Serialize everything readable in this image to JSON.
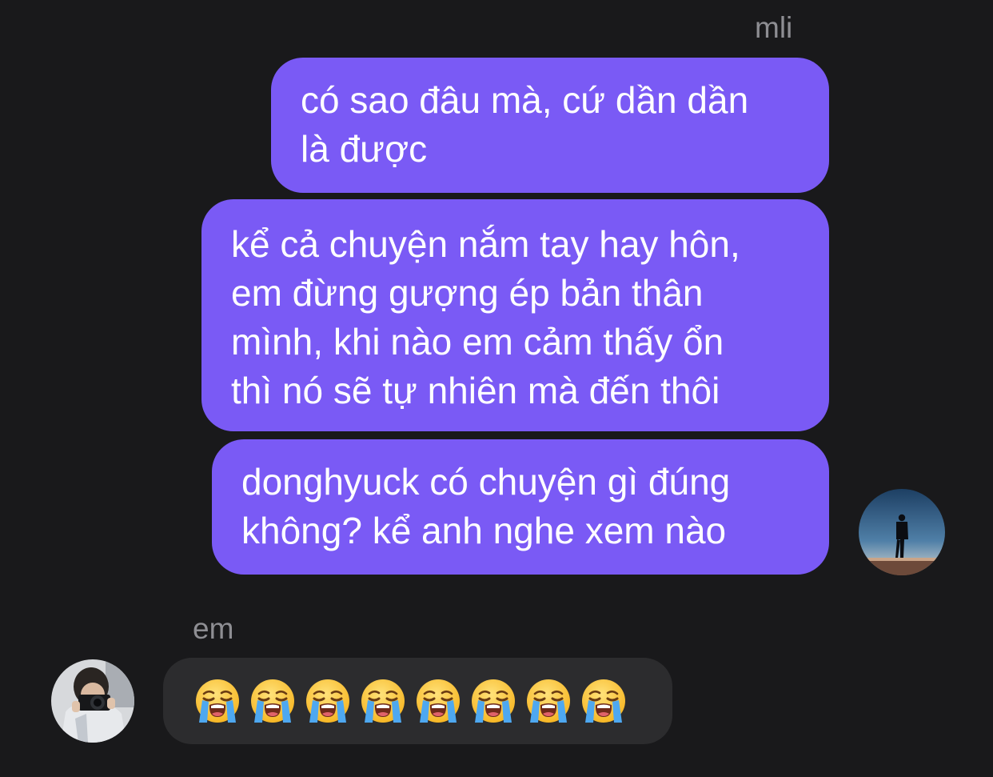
{
  "outgoing": {
    "sender_name": "mli",
    "messages": [
      {
        "lines": [
          "có sao đâu mà, cứ dần dần",
          "là được"
        ]
      },
      {
        "lines": [
          "kể cả chuyện nắm tay hay hôn,",
          "em đừng gượng ép bản thân",
          "mình, khi nào em cảm thấy ổn",
          "thì nó sẽ tự nhiên mà đến thôi"
        ]
      },
      {
        "lines": [
          "donghyuck có chuyện gì đúng",
          "không? kể anh nghe xem nào"
        ]
      }
    ],
    "avatar_icon": "profile-photo-silhouette",
    "bubble_color": "#7a5af5"
  },
  "incoming": {
    "sender_name": "em",
    "emoji_icon": "loudly-crying-face-icon",
    "emoji_count": 8,
    "avatar_icon": "profile-photo-camera",
    "bubble_color": "#2c2c2e"
  },
  "colors": {
    "background": "#19191b",
    "name_text": "#8e8e93"
  }
}
